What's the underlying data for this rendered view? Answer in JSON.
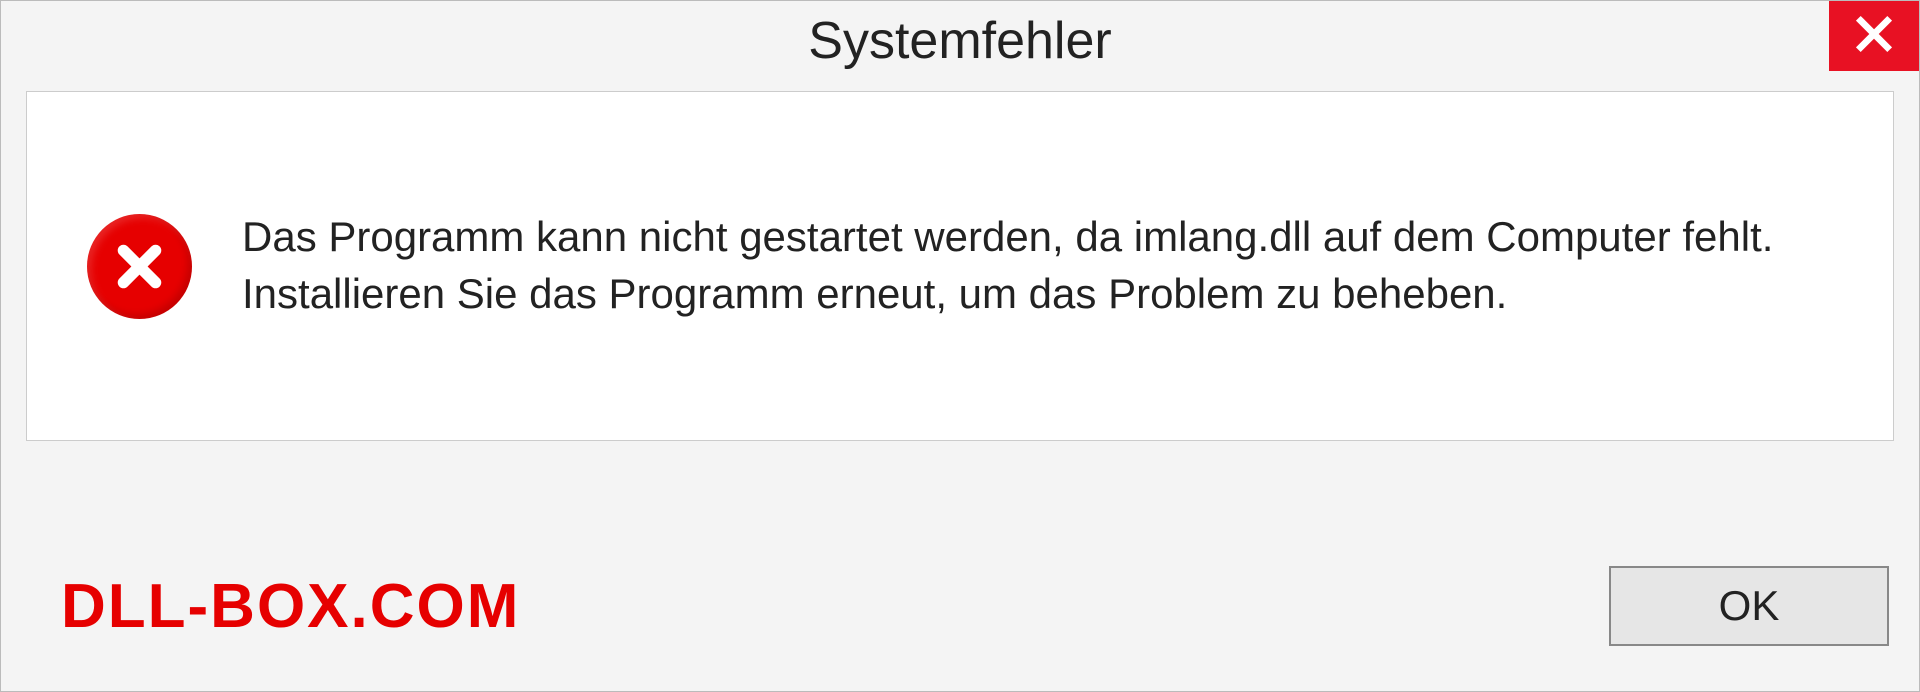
{
  "dialog": {
    "title": "Systemfehler",
    "message": "Das Programm kann nicht gestartet werden, da imlang.dll auf dem Computer fehlt. Installieren Sie das Programm erneut, um das Problem zu beheben.",
    "ok_label": "OK"
  },
  "watermark": "DLL-BOX.COM",
  "colors": {
    "close_bg": "#e81123",
    "error_icon_bg": "#e60000",
    "watermark_color": "#e60000"
  }
}
